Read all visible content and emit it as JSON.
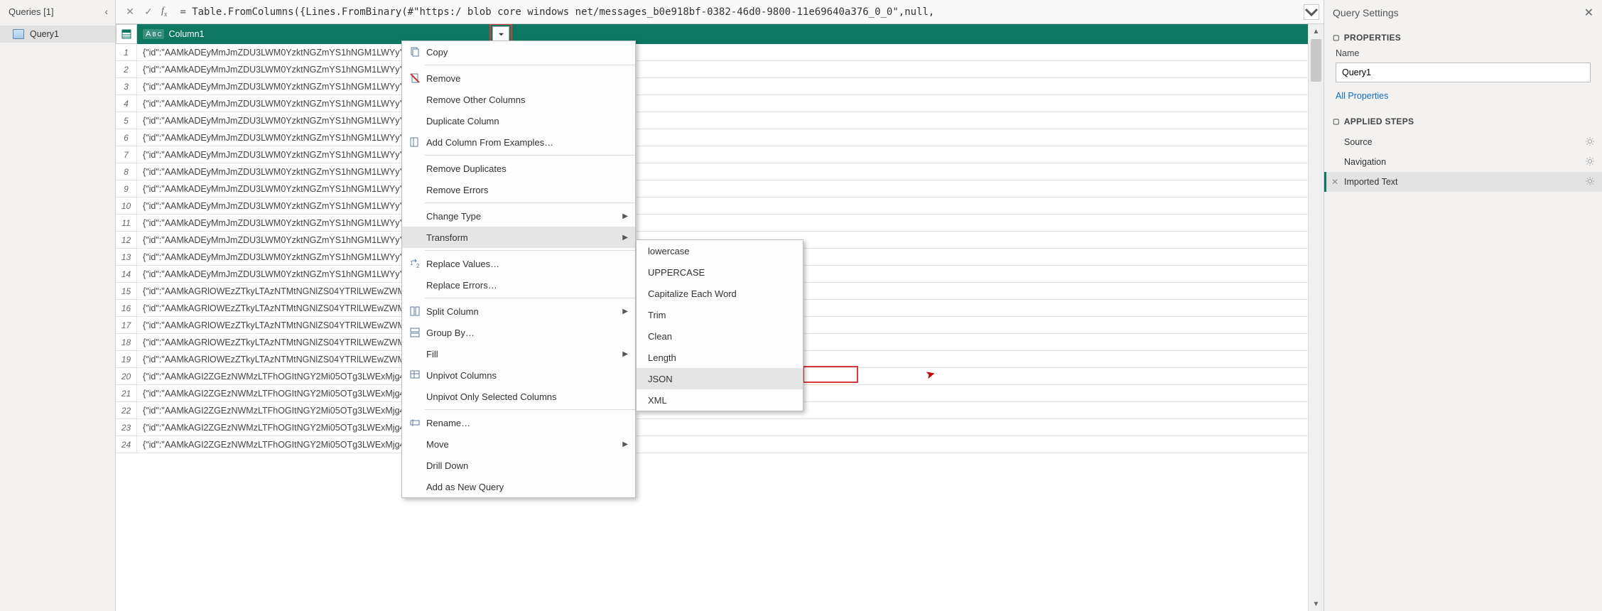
{
  "queries": {
    "title": "Queries [1]",
    "items": [
      {
        "label": "Query1"
      }
    ]
  },
  "formula_bar": {
    "prefix": "= ",
    "text": "Table.FromColumns({Lines.FromBinary(#\"https:/           blob core windows net/messages_b0e918bf-0382-46d0-9800-11e69640a376_0_0\",null,"
  },
  "table": {
    "column_header": "Column1",
    "row_prefix_a": "{\"id\":\"AAMkADEyMmJmZDU3LWM0YzktNGZmYS1hNGM1LWYyYmU2…",
    "row_prefix_b": "{\"id\":\"AAMkAGRlOWEzZTkyLTAzNTMtNGNlZS04YTRlLWEwZWM3ODk…",
    "row_prefix_c": "{\"id\":\"AAMkAGI2ZGEzNWMzLTFhOGItNGY2Mi05OTg3LWExMjg4NmU…",
    "row_count": 24
  },
  "context_menu": {
    "copy": "Copy",
    "remove": "Remove",
    "remove_other": "Remove Other Columns",
    "duplicate": "Duplicate Column",
    "add_examples": "Add Column From Examples…",
    "remove_dup": "Remove Duplicates",
    "remove_err": "Remove Errors",
    "change_type": "Change Type",
    "transform": "Transform",
    "replace_values": "Replace Values…",
    "replace_errors": "Replace Errors…",
    "split_column": "Split Column",
    "group_by": "Group By…",
    "fill": "Fill",
    "unpivot": "Unpivot Columns",
    "unpivot_sel": "Unpivot Only Selected Columns",
    "rename": "Rename…",
    "move": "Move",
    "drill": "Drill Down",
    "add_query": "Add as New Query"
  },
  "submenu": {
    "lowercase": "lowercase",
    "uppercase": "UPPERCASE",
    "cap_each": "Capitalize Each Word",
    "trim": "Trim",
    "clean": "Clean",
    "length": "Length",
    "json": "JSON",
    "xml": "XML"
  },
  "settings": {
    "title": "Query Settings",
    "properties_label": "PROPERTIES",
    "name_label": "Name",
    "name_value": "Query1",
    "all_props": "All Properties",
    "applied_label": "APPLIED STEPS",
    "steps": {
      "source": "Source",
      "navigation": "Navigation",
      "imported": "Imported Text"
    }
  }
}
